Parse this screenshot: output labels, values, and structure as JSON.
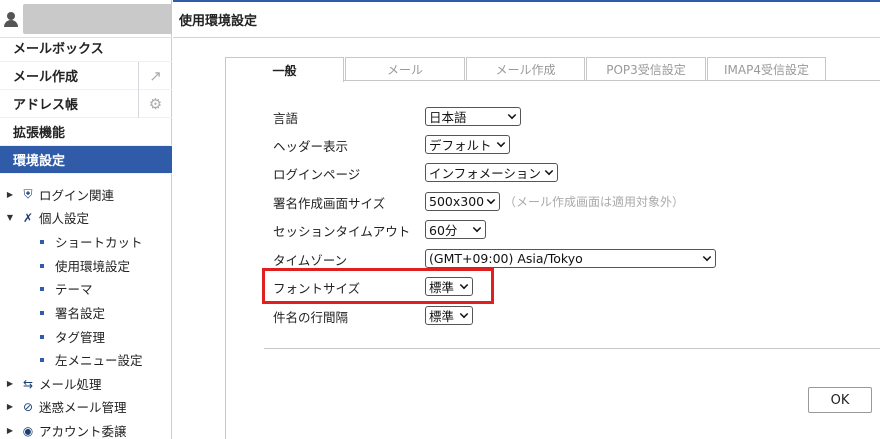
{
  "sidebar": {
    "menu": [
      {
        "label": "メールボックス"
      },
      {
        "label": "メール作成",
        "tool": "↗"
      },
      {
        "label": "アドレス帳",
        "tool": "⚙"
      },
      {
        "label": "拡張機能"
      },
      {
        "label": "環境設定",
        "active": true
      }
    ],
    "tree": [
      {
        "label": "ログイン関連",
        "icon": "shield-key-icon"
      },
      {
        "label": "個人設定",
        "icon": "tools-icon"
      }
    ],
    "children": [
      "ショートカット",
      "使用環境設定",
      "テーマ",
      "署名設定",
      "タグ管理",
      "左メニュー設定"
    ],
    "tree_after": [
      {
        "label": "メール処理",
        "icon": "swap-icon"
      },
      {
        "label": "迷惑メール管理",
        "icon": "block-icon"
      },
      {
        "label": "アカウント委譲",
        "icon": "user-circle-icon"
      }
    ]
  },
  "page": {
    "title": "使用環境設定"
  },
  "tabs": [
    "一般",
    "メール",
    "メール作成",
    "POP3受信設定",
    "IMAP4受信設定"
  ],
  "form": {
    "language": {
      "label": "言語",
      "value": "日本語"
    },
    "header": {
      "label": "ヘッダー表示",
      "value": "デフォルト"
    },
    "login_page": {
      "label": "ログインページ",
      "value": "インフォメーション"
    },
    "signature_size": {
      "label": "署名作成画面サイズ",
      "value": "500x300",
      "hint": "（メール作成画面は適用対象外）"
    },
    "session_timeout": {
      "label": "セッションタイムアウト",
      "value": "60分"
    },
    "timezone": {
      "label": "タイムゾーン",
      "value": "(GMT+09:00) Asia/Tokyo"
    },
    "font_size": {
      "label": "フォントサイズ",
      "value": "標準"
    },
    "subject_spacing": {
      "label": "件名の行間隔",
      "value": "標準"
    }
  },
  "buttons": {
    "ok": "OK"
  },
  "colors": {
    "accent": "#2f5ba8",
    "highlight": "#e02020"
  }
}
